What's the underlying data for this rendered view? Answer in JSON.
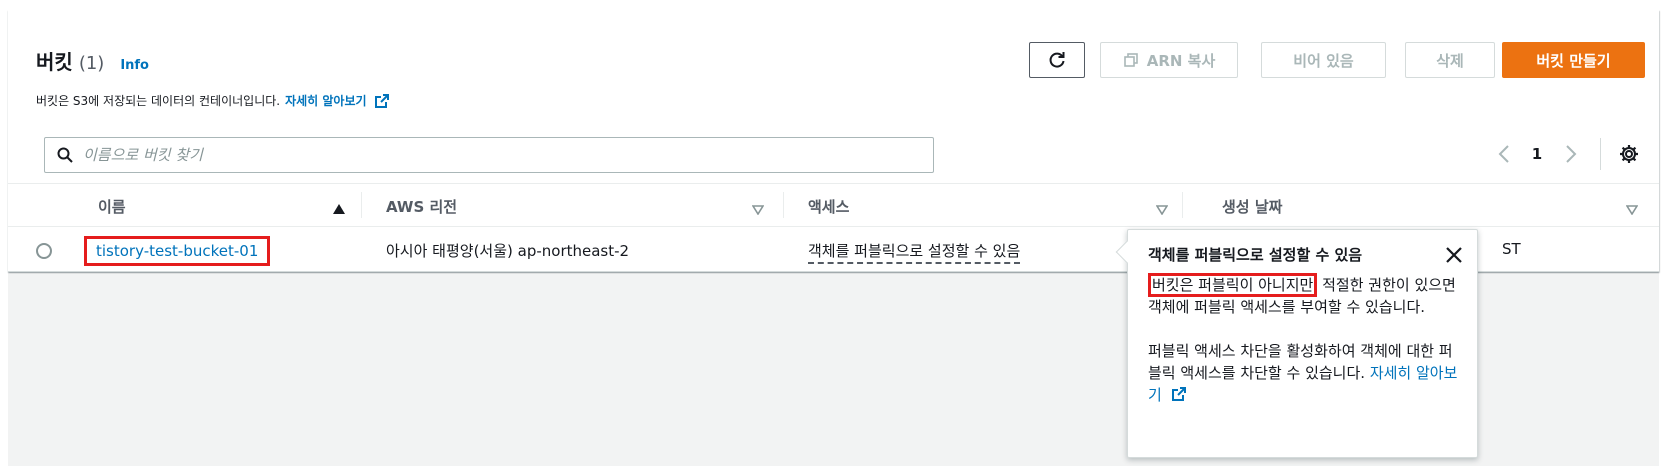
{
  "header": {
    "title": "버킷",
    "count": "(1)",
    "info": "Info",
    "description": "버킷은 S3에 저장되는 데이터의 컨테이너입니다.",
    "learn_more": "자세히 알아보기"
  },
  "toolbar": {
    "copy_arn": "ARN 복사",
    "empty": "비어 있음",
    "delete": "삭제",
    "create": "버킷 만들기"
  },
  "search": {
    "placeholder": "이름으로 버킷 찾기"
  },
  "pagination": {
    "current_page": "1"
  },
  "table": {
    "columns": [
      "이름",
      "AWS 리전",
      "액세스",
      "생성 날짜"
    ],
    "rows": [
      {
        "name": "tistory-test-bucket-01",
        "region": "아시아 태평양(서울) ap-northeast-2",
        "access": "객체를 퍼블릭으로 설정할 수 있음",
        "created_visible": "ST"
      }
    ]
  },
  "popover": {
    "title": "객체를 퍼블릭으로 설정할 수 있음",
    "highlight": "버킷은 퍼블릭이 아니지만",
    "body1_rest": " 적절한 권한이 있으면 객체에 퍼블릭 액세스를 부여할 수 있습니다.",
    "body2": "퍼블릭 액세스 차단을 활성화하여 객체에 대한 퍼블릭 액세스를 차단할 수 있습니다.",
    "link": "자세히 알아보기"
  },
  "colors": {
    "primary": "#ec7211",
    "link": "#0073bb",
    "highlight_border": "#e51d1d"
  }
}
